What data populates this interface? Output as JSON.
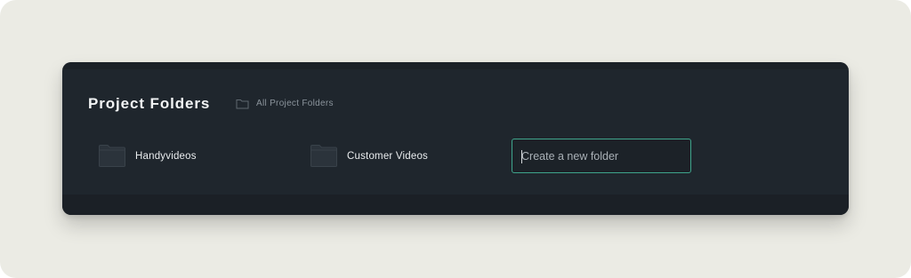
{
  "panel": {
    "title": "Project Folders",
    "all_folders_link": "All Project Folders"
  },
  "folders": [
    {
      "name": "Handyvideos",
      "icon": "folder-icon"
    },
    {
      "name": "Customer Videos",
      "icon": "folder-icon"
    }
  ],
  "new_folder": {
    "value": "",
    "placeholder": "Create a new folder"
  },
  "colors": {
    "page_background": "#ebebe4",
    "panel_background": "#1f262d",
    "input_focus_border": "#3fa58c"
  }
}
